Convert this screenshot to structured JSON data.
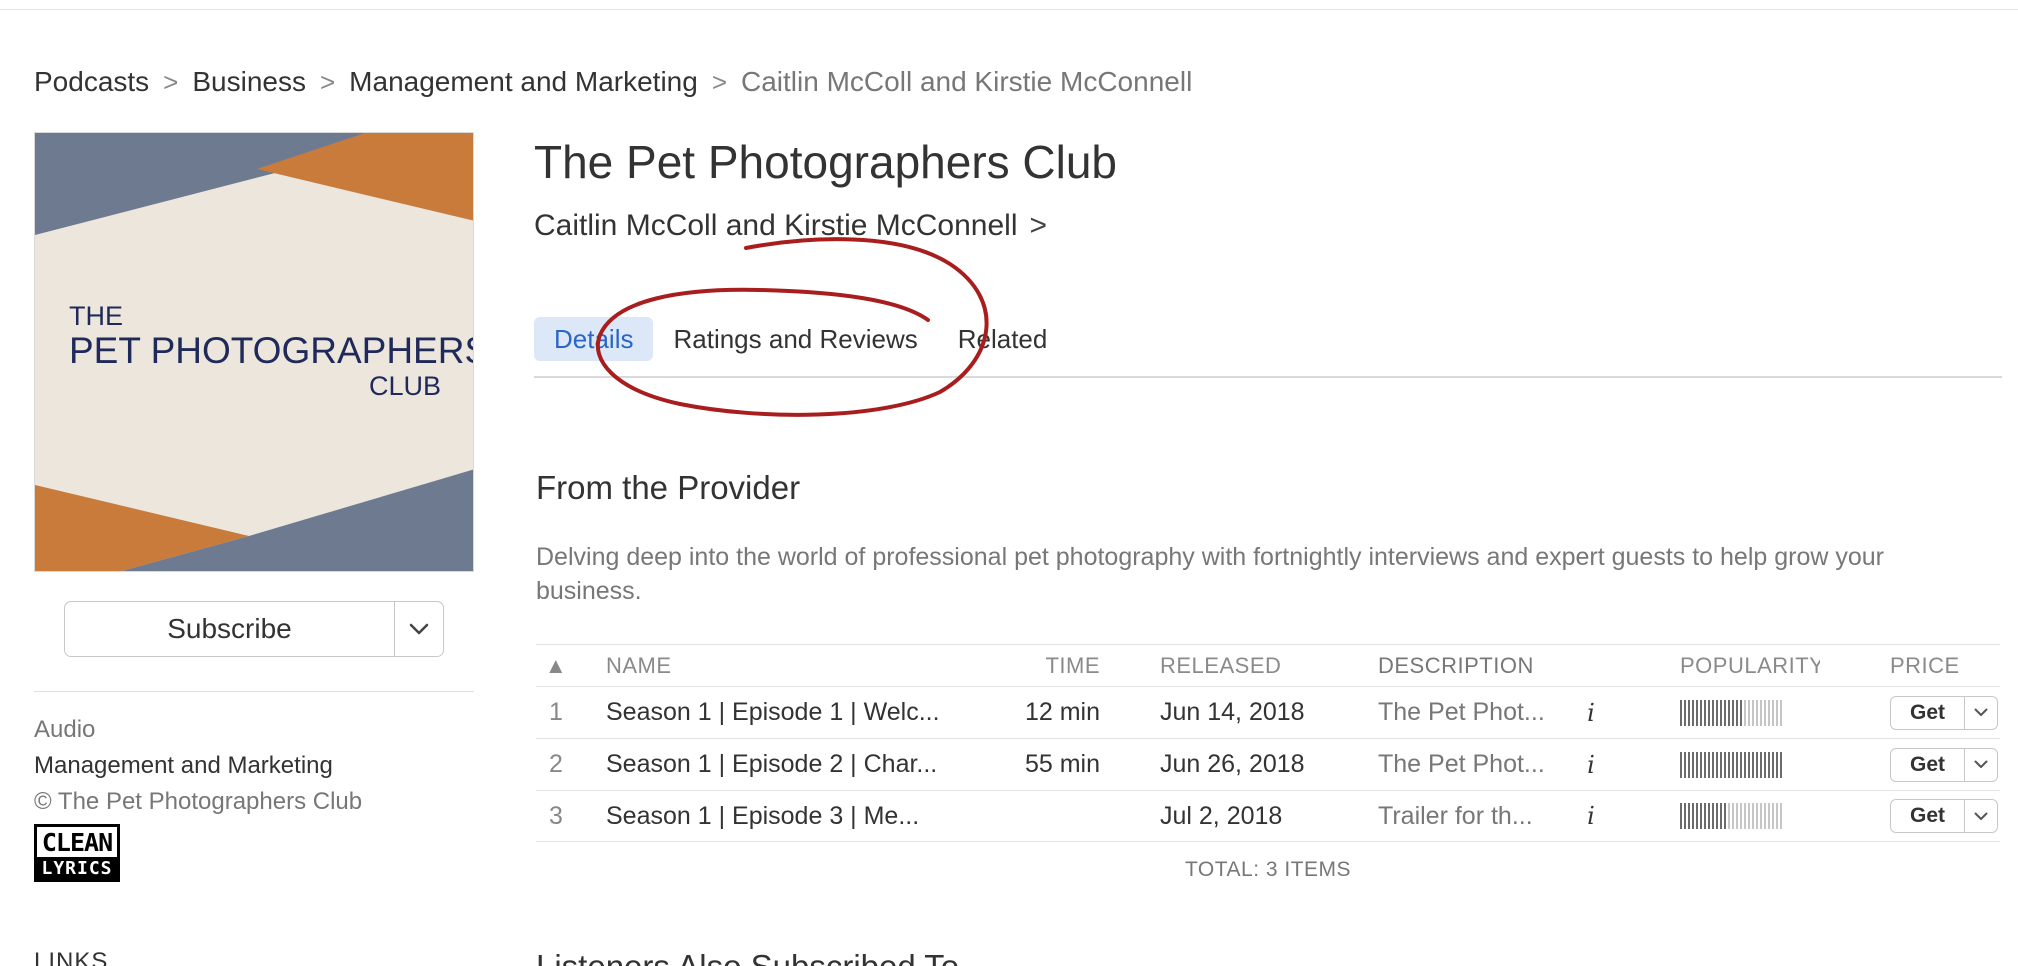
{
  "breadcrumb": {
    "items": [
      "Podcasts",
      "Business",
      "Management and Marketing"
    ],
    "current": "Caitlin McColl and Kirstie McConnell",
    "separator": ">"
  },
  "artwork": {
    "line1": "THE",
    "line2": "PET PHOTOGRAPHERS",
    "line3": "CLUB",
    "colors": {
      "background": "#ece6dd",
      "slate": "#6e7a90",
      "orange": "#c97b3b",
      "text": "#1f2a5a"
    }
  },
  "subscribe": {
    "label": "Subscribe"
  },
  "info": {
    "type": "Audio",
    "category": "Management and Marketing",
    "copyright": "© The Pet Photographers Club",
    "badge_top": "CLEAN",
    "badge_bottom": "LYRICS"
  },
  "links_heading": "LINKS",
  "podcast": {
    "title": "The Pet Photographers Club",
    "artist": "Caitlin McColl and Kirstie McConnell",
    "artist_chevron": ">"
  },
  "tabs": [
    {
      "label": "Details",
      "active": true
    },
    {
      "label": "Ratings and Reviews",
      "active": false
    },
    {
      "label": "Related",
      "active": false
    }
  ],
  "provider": {
    "heading": "From the Provider",
    "description": "Delving deep into the world of professional pet photography with fortnightly interviews and expert guests to help grow your business."
  },
  "table": {
    "sort_indicator": "▲",
    "columns": {
      "name": "NAME",
      "time": "TIME",
      "released": "RELEASED",
      "description": "DESCRIPTION",
      "popularity": "POPULARITY",
      "price": "PRICE"
    },
    "rows": [
      {
        "num": "1",
        "name": "Season 1 | Episode 1 | Welc...",
        "time": "12 min",
        "released": "Jun 14, 2018",
        "description": "The Pet Phot...",
        "info": "i",
        "popularity": 0.62,
        "price": "Get"
      },
      {
        "num": "2",
        "name": "Season 1 | Episode 2 | Char...",
        "time": "55 min",
        "released": "Jun 26, 2018",
        "description": "The Pet Phot...",
        "info": "i",
        "popularity": 1.0,
        "price": "Get"
      },
      {
        "num": "3",
        "name": "Season 1 | Episode 3 | Me...",
        "time": "",
        "released": "Jul 2, 2018",
        "description": "Trailer for th...",
        "info": "i",
        "popularity": 0.46,
        "price": "Get"
      }
    ],
    "total": "TOTAL: 3 ITEMS"
  },
  "next_section_heading": "Listeners Also Subscribed To",
  "annotation_color": "#a81e1e"
}
